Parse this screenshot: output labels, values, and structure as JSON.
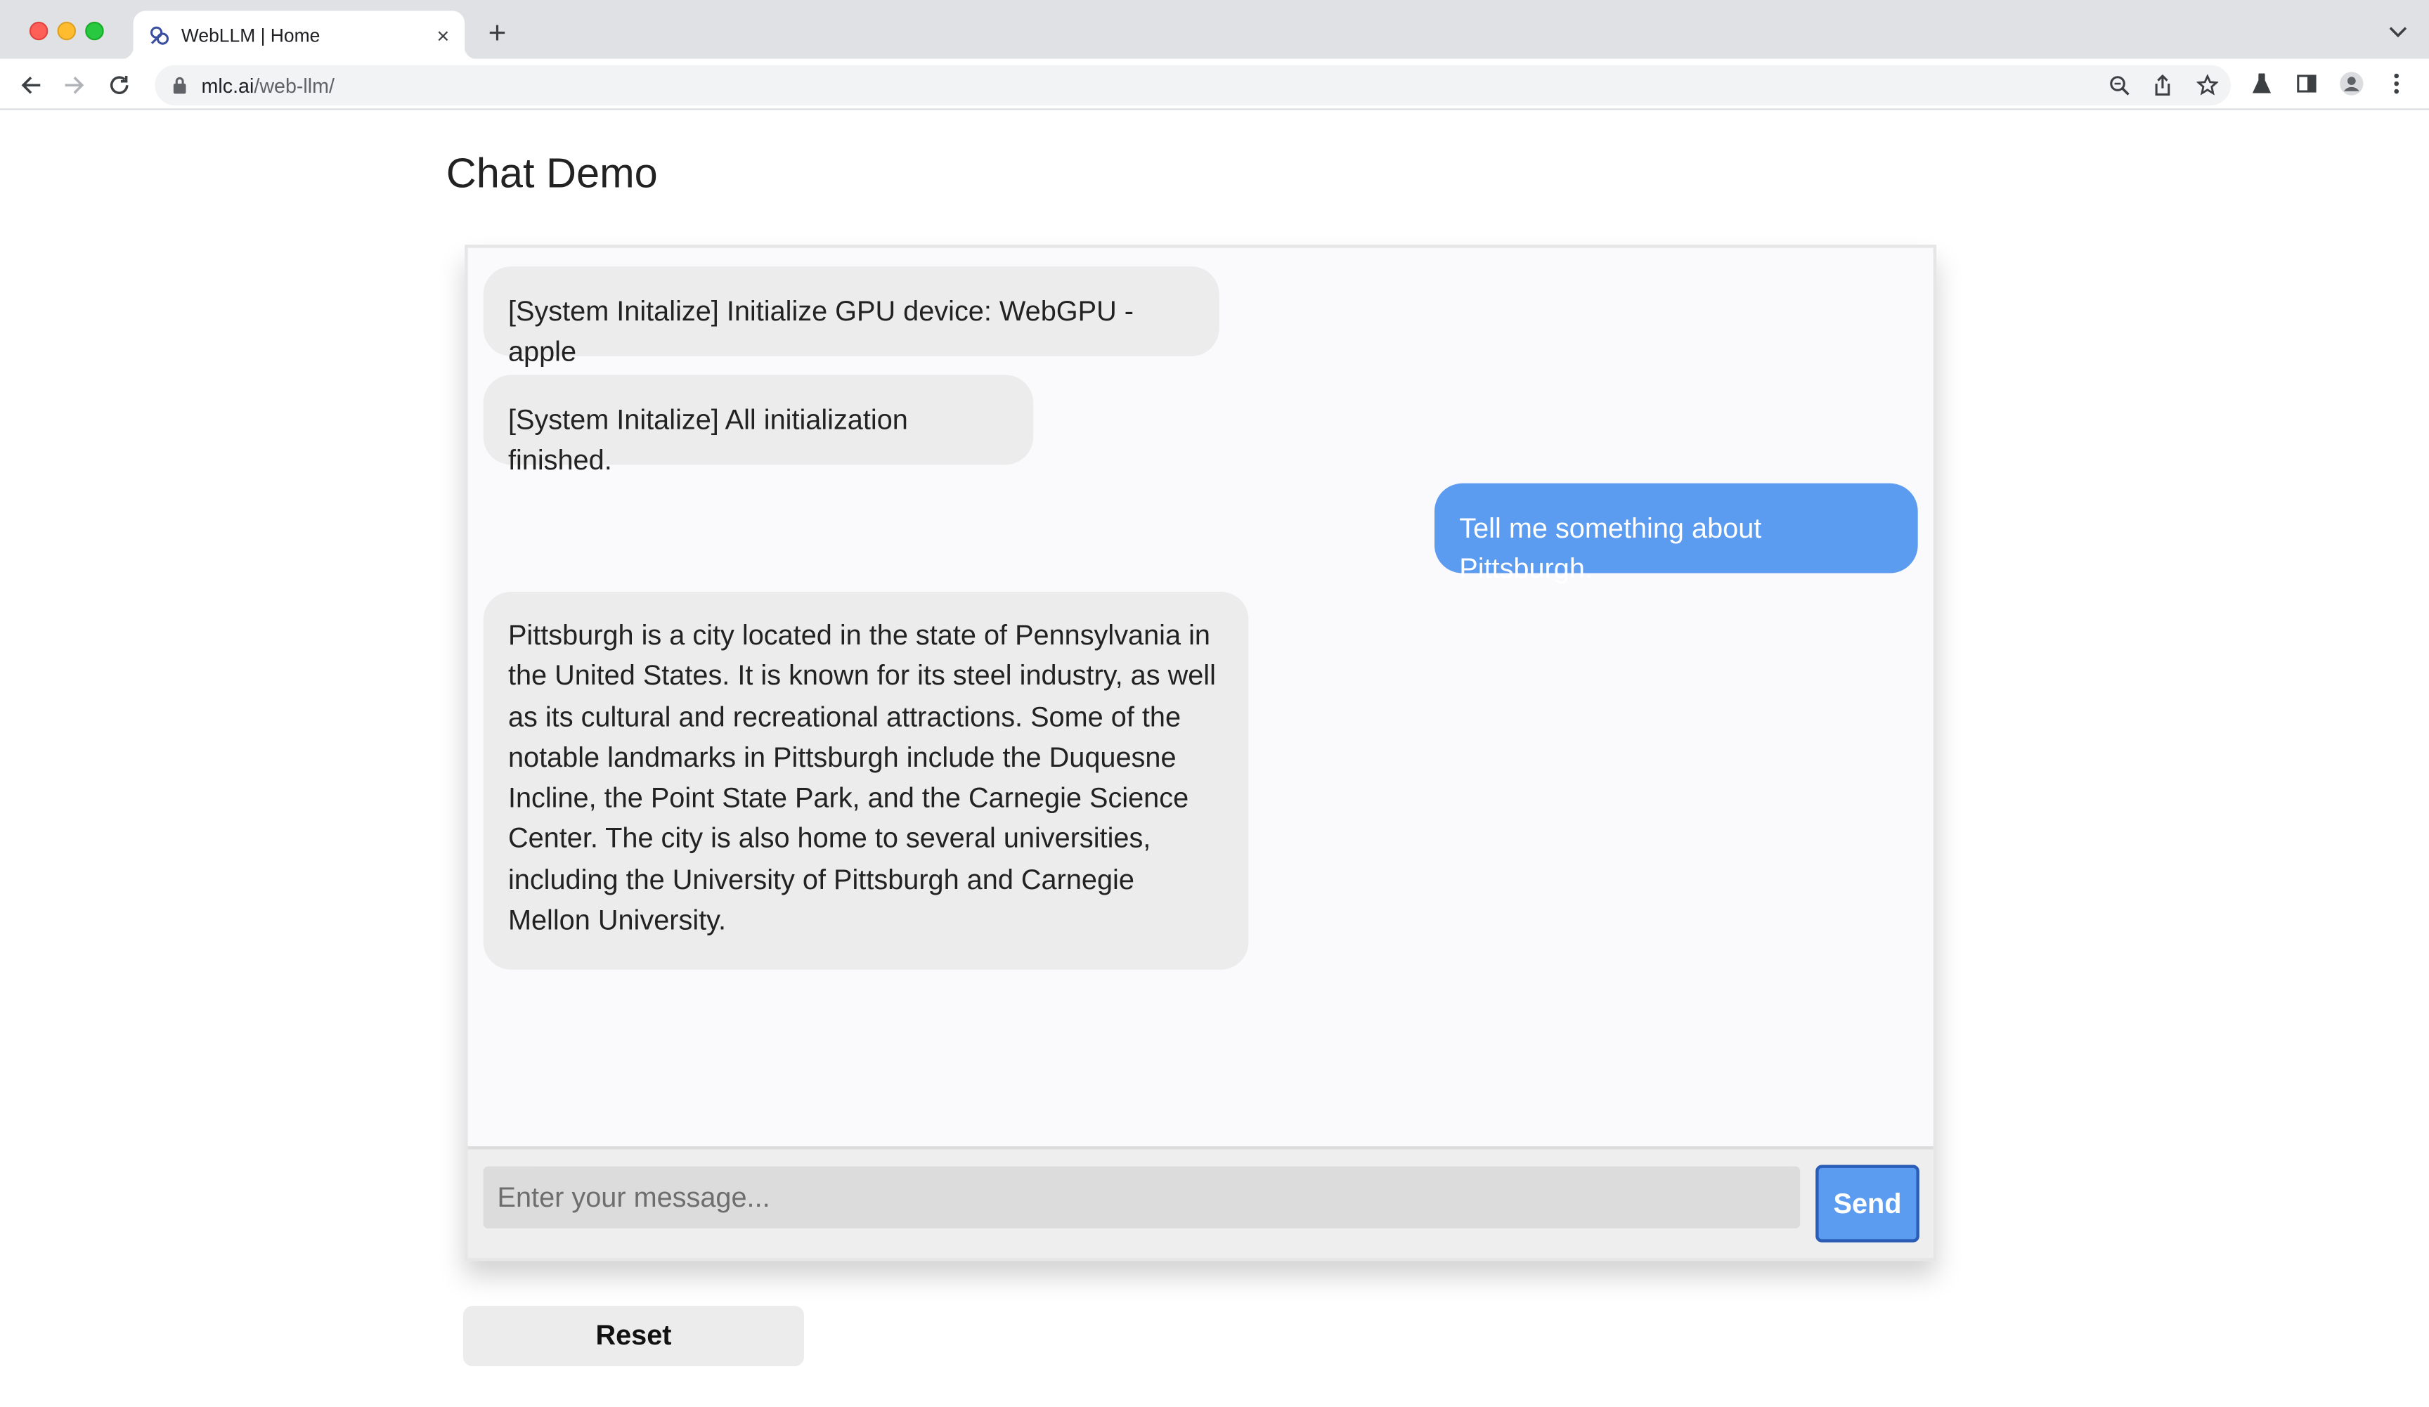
{
  "browser": {
    "tab_title": "WebLLM | Home",
    "url_host": "mlc.ai",
    "url_path": "/web-llm/",
    "new_tab_symbol": "+",
    "close_symbol": "×"
  },
  "page": {
    "title": "Chat Demo"
  },
  "chat": {
    "messages": [
      {
        "role": "system",
        "text": "[System Initalize] Initialize GPU device: WebGPU - apple"
      },
      {
        "role": "system",
        "text": "[System Initalize] All initialization finished."
      },
      {
        "role": "user",
        "text": "Tell me something about Pittsburgh."
      },
      {
        "role": "assistant",
        "text": "Pittsburgh is a city located in the state of Pennsylvania in the United States. It is known for its steel industry, as well as its cultural and recreational attractions. Some of the notable landmarks in Pittsburgh include the Duquesne Incline, the Point State Park, and the Carnegie Science Center. The city is also home to several universities, including the University of Pittsburgh and Carnegie Mellon University."
      }
    ],
    "input_placeholder": "Enter your message...",
    "input_value": "",
    "send_label": "Send",
    "reset_label": "Reset"
  },
  "colors": {
    "user_bubble": "#5b9bf0",
    "bot_bubble": "#ececec",
    "send_border": "#2a5db8"
  },
  "icons": [
    "back-icon",
    "forward-icon",
    "reload-icon",
    "lock-icon",
    "zoom-icon",
    "share-icon",
    "star-icon",
    "labs-icon",
    "side-panel-icon",
    "profile-icon",
    "menu-icon",
    "tab-search-icon",
    "favicon-icon"
  ]
}
